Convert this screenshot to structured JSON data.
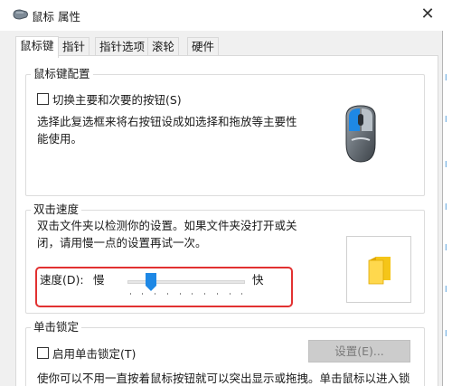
{
  "window": {
    "title": "鼠标 属性",
    "close_glyph": "✕"
  },
  "tabs": [
    {
      "label": "鼠标键"
    },
    {
      "label": "指针"
    },
    {
      "label": "指针选项"
    },
    {
      "label": "滚轮"
    },
    {
      "label": "硬件"
    }
  ],
  "button_config": {
    "group_title": "鼠标键配置",
    "swap_checkbox_label": "切换主要和次要的按钮(S)",
    "swap_checked": false,
    "description_line1": "选择此复选框来将右按钮设成如选择和拖放等主要性",
    "description_line2": "能使用。"
  },
  "double_click": {
    "group_title": "双击速度",
    "description_line1": "双击文件夹以检测你的设置。如果文件夹没打开或关",
    "description_line2": "闭，请用慢一点的设置再试一次。",
    "speed_label": "速度(D):",
    "slow_label": "慢",
    "fast_label": "快",
    "speed_fraction": 0.2
  },
  "click_lock": {
    "group_title": "单击锁定",
    "checkbox_label": "启用单击锁定(T)",
    "checked": false,
    "settings_button_label": "设置(E)...",
    "description": "使你可以不用一直按着鼠标按钮就可以突出显示或拖拽。单击鼠标以进入锁"
  },
  "colors": {
    "highlight_border": "#e23131",
    "accent_blue": "#1e88e5",
    "folder_yellow": "#f5c518"
  }
}
